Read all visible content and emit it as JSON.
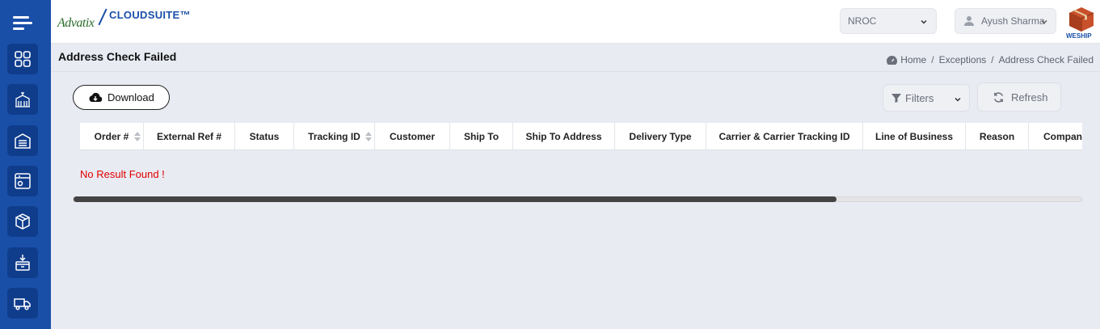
{
  "header": {
    "logo": {
      "left_text": "Advatix",
      "right_text": "CLOUDSUITE™"
    },
    "warehouse_select": {
      "value": "NROC"
    },
    "user_select": {
      "name": "Ayush Sharma"
    },
    "brand_badge": "WESHIP"
  },
  "page": {
    "title": "Address Check Failed",
    "breadcrumb": [
      "Home",
      "Exceptions",
      "Address Check Failed"
    ]
  },
  "toolbar": {
    "download_label": "Download",
    "filters_label": "Filters",
    "refresh_label": "Refresh"
  },
  "table": {
    "columns": [
      "Order #",
      "External Ref #",
      "Status",
      "Tracking ID",
      "Customer",
      "Ship To",
      "Ship To Address",
      "Delivery Type",
      "Carrier & Carrier Tracking ID",
      "Line of Business",
      "Reason",
      "Company"
    ],
    "sortable": [
      "Order #",
      "Tracking ID"
    ],
    "rows": [],
    "empty_message": "No Result Found !"
  },
  "scrollbar": {
    "position_fraction": 0.0,
    "visible_fraction": 0.757
  },
  "sidebar": {
    "items": [
      "dashboard-icon",
      "warehouse-icon",
      "inventory-icon",
      "settings-window-icon",
      "packages-icon",
      "receiving-icon",
      "truck-icon"
    ]
  },
  "colors": {
    "sidebar": "#1a4fa8",
    "sidebar_button": "#0f3d8c",
    "error_text": "#e00000",
    "brand_blue": "#1a4fa8"
  }
}
